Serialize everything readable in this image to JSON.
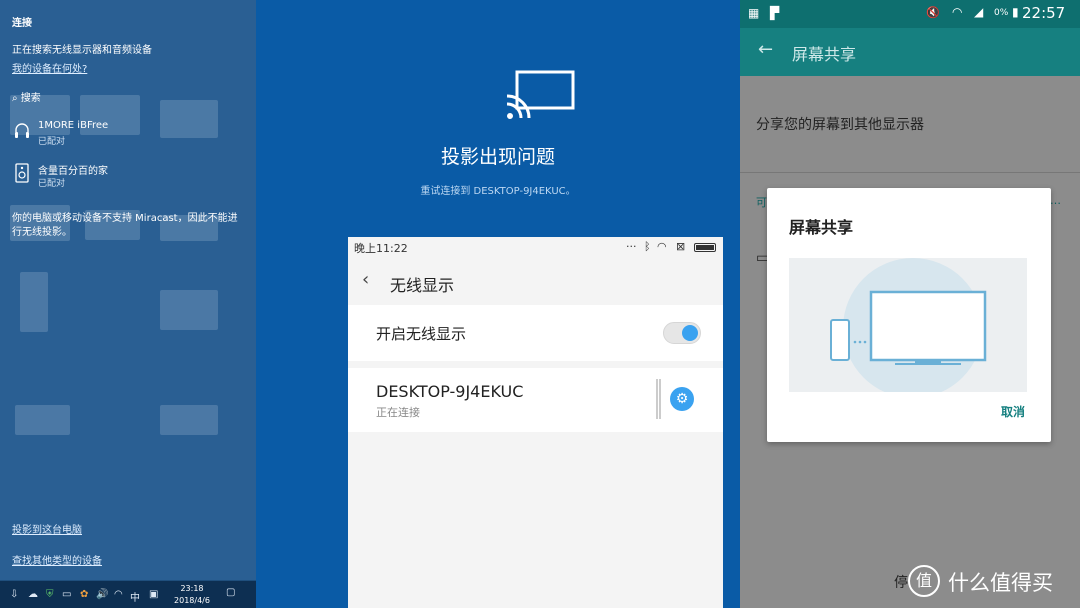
{
  "left_panel": {
    "title": "连接",
    "searching": "正在搜索无线显示器和音频设备",
    "where_link": "我的设备在何处?",
    "search_label": "搜索",
    "devices": [
      {
        "name": "1MORE iBFree",
        "status": "已配对",
        "icon": "headset-icon"
      },
      {
        "name": "含量百分百的家",
        "status": "已配对",
        "icon": "speaker-icon"
      }
    ],
    "error_line1": "你的电脑或移动设备不支持 Miracast，因此不能进",
    "error_line2": "行无线投影。",
    "project_link": "投影到这台电脑",
    "find_link": "查找其他类型的设备",
    "clock_time": "23:18",
    "clock_date": "2018/4/6",
    "ime": "中"
  },
  "center": {
    "title": "投影出现问题",
    "subtitle": "重试连接到 DESKTOP-9J4EKUC。"
  },
  "phone": {
    "status_time": "晚上11:22",
    "header_title": "无线显示",
    "toggle_label": "开启无线显示",
    "toggle_on": true,
    "device_name": "DESKTOP-9J4EKUC",
    "device_status": "正在连接",
    "accent": "#3aa2f0"
  },
  "android": {
    "status_time": "22:57",
    "battery": "0%",
    "appbar_title": "屏幕共享",
    "body_text": "分享您的屏幕到其他显示器",
    "partial_left": "可",
    "stop_partial": "停",
    "dialog_title": "屏幕共享",
    "dialog_cancel": "取消",
    "accent": "#168080"
  },
  "watermark": {
    "text": "什么值得买",
    "logo": "值"
  }
}
